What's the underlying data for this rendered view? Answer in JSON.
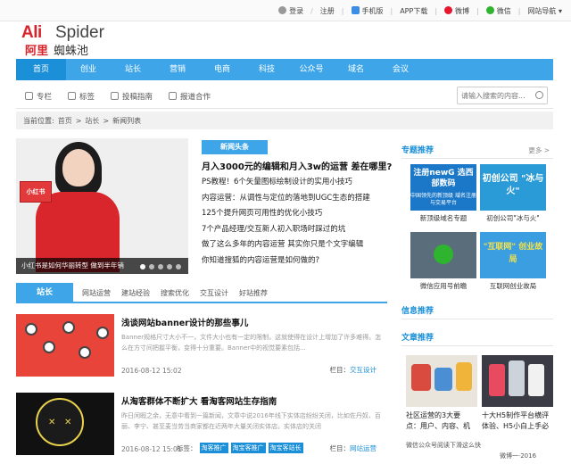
{
  "topbar": {
    "login": "登录",
    "sep": "/",
    "register": "注册",
    "mobile": "手机版",
    "app": "APP下载",
    "weibo": "微博",
    "wechat": "微信",
    "sitenav": "网站导航"
  },
  "logo": {
    "ali": "Ali",
    "spider": "Spider",
    "cn1": "阿里",
    "cn2": "蜘蛛池"
  },
  "nav": [
    "首页",
    "创业",
    "站长",
    "营销",
    "电商",
    "科技",
    "公众号",
    "域名",
    "会议"
  ],
  "subnav": {
    "items": [
      "专栏",
      "标签",
      "投稿指南",
      "报道合作"
    ],
    "search_placeholder": "请输入搜索的内容..."
  },
  "breadcrumb": {
    "label": "当前位置:",
    "home": "首页",
    "gt": ">",
    "mid": "站长",
    "current": "新闻列表"
  },
  "hero": {
    "caption": "小红书是如何华丽转型 做到半年销",
    "box": "小红书"
  },
  "news": {
    "badge": "新闻头条",
    "headline": "月入3000元的编辑和月入3w的运营 差在哪里?",
    "items": [
      "PS教程！6个矢量图标绘制设计的实用小技巧",
      "内容运营：从调性与定位的落地到UGC生态的搭建",
      "125个提升网页可用性的优化小技巧",
      "7个产品经理/交互新人初入职场时踩过的坑",
      "做了这么多年的内容运营 其实你只是个文字编辑",
      "你知道搜狐的内容运营是如何做的?"
    ]
  },
  "tabs": {
    "active": "站长",
    "items": [
      "网站运营",
      "建站经验",
      "搜索优化",
      "交互设计",
      "好站推荐"
    ]
  },
  "articles": [
    {
      "title": "浅谈网站banner设计的那些事儿",
      "desc": "Banner规格尺寸大小不一，文件大小也有一定的限制，这就使得在设计上增加了许多难得。怎么在方寸间把握平衡，变得十分重要。Banner中的视觉要素包括...",
      "date": "2016-08-12 15:02",
      "col_label": "栏目：",
      "col": "交互设计"
    },
    {
      "title": "从淘客群体不断扩大 看淘客网站生存指南",
      "desc": "昨日闲暇之余，无意中看到一篇新闻，文章中说2016年线下实体店纷纷关闭，比如佐丹奴、百丽、李宁、甚至麦当劳当商家都在近两年大量关闭实体店。实体店的关闭",
      "date": "2016-08-12 15:01",
      "tags_label": "标签：",
      "tags": [
        "淘客推广",
        "淘宝客推广",
        "淘宝客站长"
      ],
      "col_label": "栏目：",
      "col": "网站运营"
    }
  ],
  "sidebar": {
    "special": {
      "title": "专题推荐",
      "more": "更多 >"
    },
    "tiles": [
      {
        "big": "注册newG 选西部数码",
        "small": "中国领先的新顶级 域名注册与交易平台",
        "label": "新顶级域名专题",
        "color": "#1b78c9"
      },
      {
        "big": "初创公司 \"冰与火\"",
        "small": "",
        "label": "初创公司\"冰与火\"",
        "color": "#2a9bd7"
      },
      {
        "big": "",
        "small": "",
        "label": "微信应用号前瞻",
        "color": "#5a6d7a"
      },
      {
        "big": "\"互联网\" 创业故局",
        "small": "",
        "label": "互联网创业故局",
        "color": "#3a9ee0"
      }
    ],
    "info": {
      "title": "信息推荐"
    },
    "articles": {
      "title": "文章推荐"
    },
    "rec": [
      {
        "line1": "社区运营的3大要",
        "line2": "点：用户、内容、机"
      },
      {
        "line1": "十大H5制作平台横评",
        "line2": "体验、H5小白上手必"
      }
    ],
    "foot1": "微信公众号阅读下滑这么快",
    "foot2": "微博一·2016"
  },
  "colors": {
    "accent": "#3ea6e8",
    "accent_dark": "#1b8fd8",
    "brand_red": "#d8232a"
  }
}
